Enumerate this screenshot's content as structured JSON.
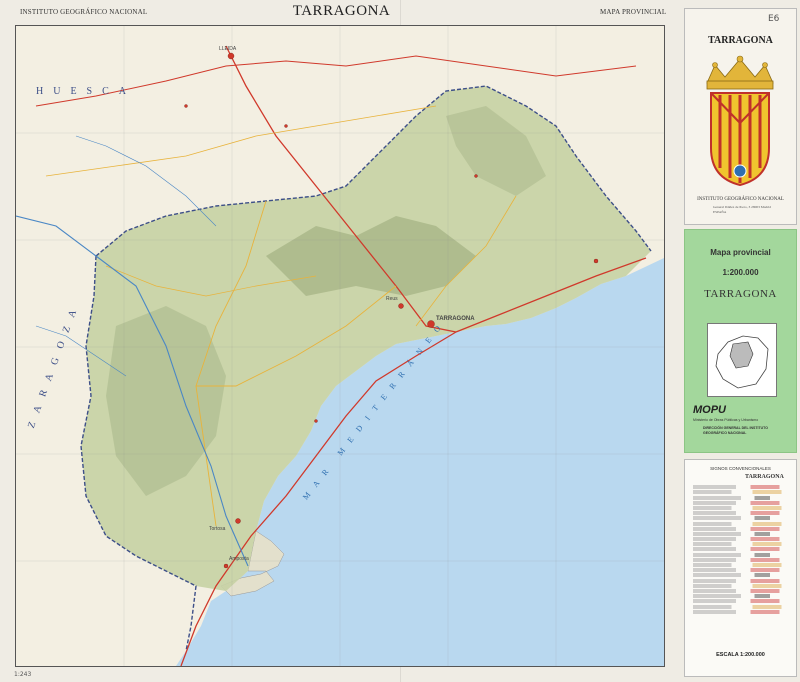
{
  "header": {
    "institute": "INSTITUTO GEOGRÁFICO NACIONAL",
    "title": "TARRAGONA",
    "map_type": "MAPA PROVINCIAL"
  },
  "panel_top": {
    "title": "TARRAGONA",
    "institute": "INSTITUTO GEOGRÁFICO NACIONAL",
    "address": "General Ibáñez de Ibero, 3 28003 Madrid ESPAÑA",
    "stamp": "E6"
  },
  "panel_green": {
    "map_type": "Mapa provincial",
    "scale": "1:200.000",
    "title": "TARRAGONA",
    "publisher": "MOPU",
    "ministry": "Ministerio de Obras Públicas y Urbanismo",
    "direction": "DIRECCIÓN GENERAL DEL INSTITUTO GEOGRÁFICO NACIONAL"
  },
  "legend": {
    "heading": "SIGNOS CONVENCIONALES",
    "sample_city": "TARRAGONA",
    "scale": "ESCALA 1:200.000"
  },
  "map": {
    "sea_name": "MAR MEDITERRÁNEO",
    "neighbor_huesca": "HUESCA",
    "neighbor_zaragoza": "ZARAGOZA",
    "city_lleida": "LLEIDA",
    "city_tarragona": "TARRAGONA",
    "city_reus": "Reus",
    "town_amposta": "Amposta",
    "town_tortosa": "Tortosa",
    "colors": {
      "sea": "#b9d8ef",
      "land": "#f3efe2",
      "relief": "#c6d2a4",
      "roads_main": "#d0392b",
      "roads_secondary": "#e8b33c",
      "province_border": "#3d4f88"
    }
  },
  "bottom_mark": "1:243"
}
